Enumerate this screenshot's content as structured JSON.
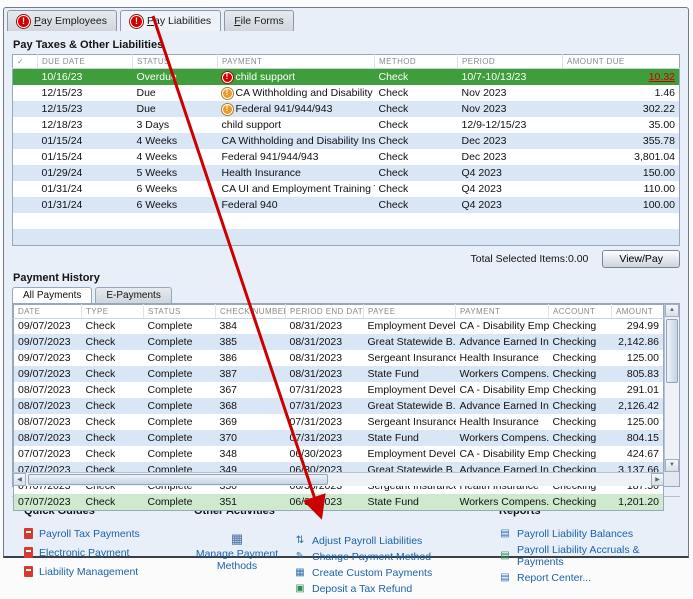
{
  "icons": {
    "alert_glyph": "!",
    "scroll_up": "▲",
    "scroll_down": "▼",
    "scroll_left": "◀",
    "scroll_right": "▶",
    "check_header": "✓",
    "manage_glyph": "▦"
  },
  "colors": {
    "selected_row_green": "#3f9d3c",
    "highlight_row_green": "#cfe9cf",
    "alert_red": "#d40000",
    "alert_orange": "#e89a2a",
    "link_blue": "#1b62a8",
    "overdue_amount_red": "#cc0000",
    "arrow_red": "#cc0000"
  },
  "tabs": [
    {
      "label": "Pay Employees",
      "alert": true
    },
    {
      "label": "Pay Liabilities",
      "alert": true,
      "selected": true
    },
    {
      "label": "File Forms",
      "alert": false
    }
  ],
  "liabilities": {
    "title": "Pay Taxes & Other Liabilities",
    "columns": [
      "✓",
      "DUE DATE",
      "STATUS",
      "PAYMENT",
      "METHOD",
      "PERIOD",
      "AMOUNT DUE"
    ],
    "rows": [
      {
        "due_date": "10/16/23",
        "status": "Overdue",
        "payment": "child support",
        "method": "Check",
        "period": "10/7-10/13/23",
        "amount": "10.32",
        "alert": "red",
        "selected": true,
        "amount_alert": true
      },
      {
        "due_date": "12/15/23",
        "status": "Due",
        "payment": "CA Withholding and Disability Insurance",
        "method": "Check",
        "period": "Nov 2023",
        "amount": "1.46",
        "alert": "orange"
      },
      {
        "due_date": "12/15/23",
        "status": "Due",
        "payment": "Federal 941/944/943",
        "method": "Check",
        "period": "Nov 2023",
        "amount": "302.22",
        "alert": "orange"
      },
      {
        "due_date": "12/18/23",
        "status": "3 Days",
        "payment": "child support",
        "method": "Check",
        "period": "12/9-12/15/23",
        "amount": "35.00"
      },
      {
        "due_date": "01/15/24",
        "status": "4 Weeks",
        "payment": "CA Withholding and Disability Insurance",
        "method": "Check",
        "period": "Dec 2023",
        "amount": "355.78"
      },
      {
        "due_date": "01/15/24",
        "status": "4 Weeks",
        "payment": "Federal 941/944/943",
        "method": "Check",
        "period": "Dec 2023",
        "amount": "3,801.04"
      },
      {
        "due_date": "01/29/24",
        "status": "5 Weeks",
        "payment": "Health Insurance",
        "method": "Check",
        "period": "Q4 2023",
        "amount": "150.00"
      },
      {
        "due_date": "01/31/24",
        "status": "6 Weeks",
        "payment": "CA UI and Employment Training Tax",
        "method": "Check",
        "period": "Q4 2023",
        "amount": "110.00"
      },
      {
        "due_date": "01/31/24",
        "status": "6 Weeks",
        "payment": "Federal 940",
        "method": "Check",
        "period": "Q4 2023",
        "amount": "100.00"
      }
    ],
    "total_label": "Total Selected Items:0.00",
    "view_pay_label": "View/Pay"
  },
  "payment_history": {
    "title": "Payment History",
    "tabs": [
      {
        "label": "All Payments",
        "selected": true
      },
      {
        "label": "E-Payments",
        "selected": false
      }
    ],
    "columns": [
      "DATE",
      "TYPE",
      "STATUS",
      "CHECK NUMBER",
      "PERIOD END DATE",
      "PAYEE",
      "PAYMENT",
      "ACCOUNT",
      "AMOUNT"
    ],
    "rows": [
      {
        "date": "09/07/2023",
        "type": "Check",
        "status": "Complete",
        "check_number": "384",
        "period_end_date": "08/31/2023",
        "payee": "Employment Devel...",
        "payment": "CA - Disability Emp...",
        "account": "Checking",
        "amount": "294.99"
      },
      {
        "date": "09/07/2023",
        "type": "Check",
        "status": "Complete",
        "check_number": "385",
        "period_end_date": "08/31/2023",
        "payee": "Great Statewide B...",
        "payment": "Advance Earned In...",
        "account": "Checking",
        "amount": "2,142.86"
      },
      {
        "date": "09/07/2023",
        "type": "Check",
        "status": "Complete",
        "check_number": "386",
        "period_end_date": "08/31/2023",
        "payee": "Sergeant Insurance",
        "payment": "Health Insurance",
        "account": "Checking",
        "amount": "125.00"
      },
      {
        "date": "09/07/2023",
        "type": "Check",
        "status": "Complete",
        "check_number": "387",
        "period_end_date": "08/31/2023",
        "payee": "State Fund",
        "payment": "Workers Compens...",
        "account": "Checking",
        "amount": "805.83"
      },
      {
        "date": "08/07/2023",
        "type": "Check",
        "status": "Complete",
        "check_number": "367",
        "period_end_date": "07/31/2023",
        "payee": "Employment Devel...",
        "payment": "CA - Disability Emp...",
        "account": "Checking",
        "amount": "291.01"
      },
      {
        "date": "08/07/2023",
        "type": "Check",
        "status": "Complete",
        "check_number": "368",
        "period_end_date": "07/31/2023",
        "payee": "Great Statewide B...",
        "payment": "Advance Earned In...",
        "account": "Checking",
        "amount": "2,126.42"
      },
      {
        "date": "08/07/2023",
        "type": "Check",
        "status": "Complete",
        "check_number": "369",
        "period_end_date": "07/31/2023",
        "payee": "Sergeant Insurance",
        "payment": "Health Insurance",
        "account": "Checking",
        "amount": "125.00"
      },
      {
        "date": "08/07/2023",
        "type": "Check",
        "status": "Complete",
        "check_number": "370",
        "period_end_date": "07/31/2023",
        "payee": "State Fund",
        "payment": "Workers Compens...",
        "account": "Checking",
        "amount": "804.15"
      },
      {
        "date": "07/07/2023",
        "type": "Check",
        "status": "Complete",
        "check_number": "348",
        "period_end_date": "06/30/2023",
        "payee": "Employment Devel...",
        "payment": "CA - Disability Emp...",
        "account": "Checking",
        "amount": "424.67"
      },
      {
        "date": "07/07/2023",
        "type": "Check",
        "status": "Complete",
        "check_number": "349",
        "period_end_date": "06/30/2023",
        "payee": "Great Statewide B...",
        "payment": "Advance Earned In...",
        "account": "Checking",
        "amount": "3,137.66"
      },
      {
        "date": "07/07/2023",
        "type": "Check",
        "status": "Complete",
        "check_number": "350",
        "period_end_date": "06/30/2023",
        "payee": "Sergeant Insurance",
        "payment": "Health Insurance",
        "account": "Checking",
        "amount": "187.50"
      },
      {
        "date": "07/07/2023",
        "type": "Check",
        "status": "Complete",
        "check_number": "351",
        "period_end_date": "06/30/2023",
        "payee": "State Fund",
        "payment": "Workers Compens...",
        "account": "Checking",
        "amount": "1,201.20",
        "highlight": true
      }
    ]
  },
  "quick_guides": {
    "title": "Quick Guides",
    "links": [
      {
        "label": "Payroll Tax Payments"
      },
      {
        "label": "Electronic Payment"
      },
      {
        "label": "Liability Management"
      }
    ]
  },
  "other_activities": {
    "title": "Other Activities",
    "manage_label": "Manage Payment Methods",
    "links": [
      {
        "label": "Adjust Payroll Liabilities",
        "glyph": "⇅",
        "color": "#2e6db4"
      },
      {
        "label": "Change Payment Method",
        "glyph": "✎",
        "color": "#2e6db4"
      },
      {
        "label": "Create Custom Payments",
        "glyph": "▦",
        "color": "#2e6db4"
      },
      {
        "label": "Deposit a Tax Refund",
        "glyph": "▣",
        "color": "#2e8b57"
      }
    ]
  },
  "reports": {
    "title": "Reports",
    "links": [
      {
        "label": "Payroll Liability Balances",
        "glyph": "▤",
        "color": "#2e6db4"
      },
      {
        "label": "Payroll Liability Accruals & Payments",
        "glyph": "▤",
        "color": "#2e8b57"
      },
      {
        "label": "Report Center...",
        "glyph": "▤",
        "color": "#2e6db4"
      }
    ]
  }
}
